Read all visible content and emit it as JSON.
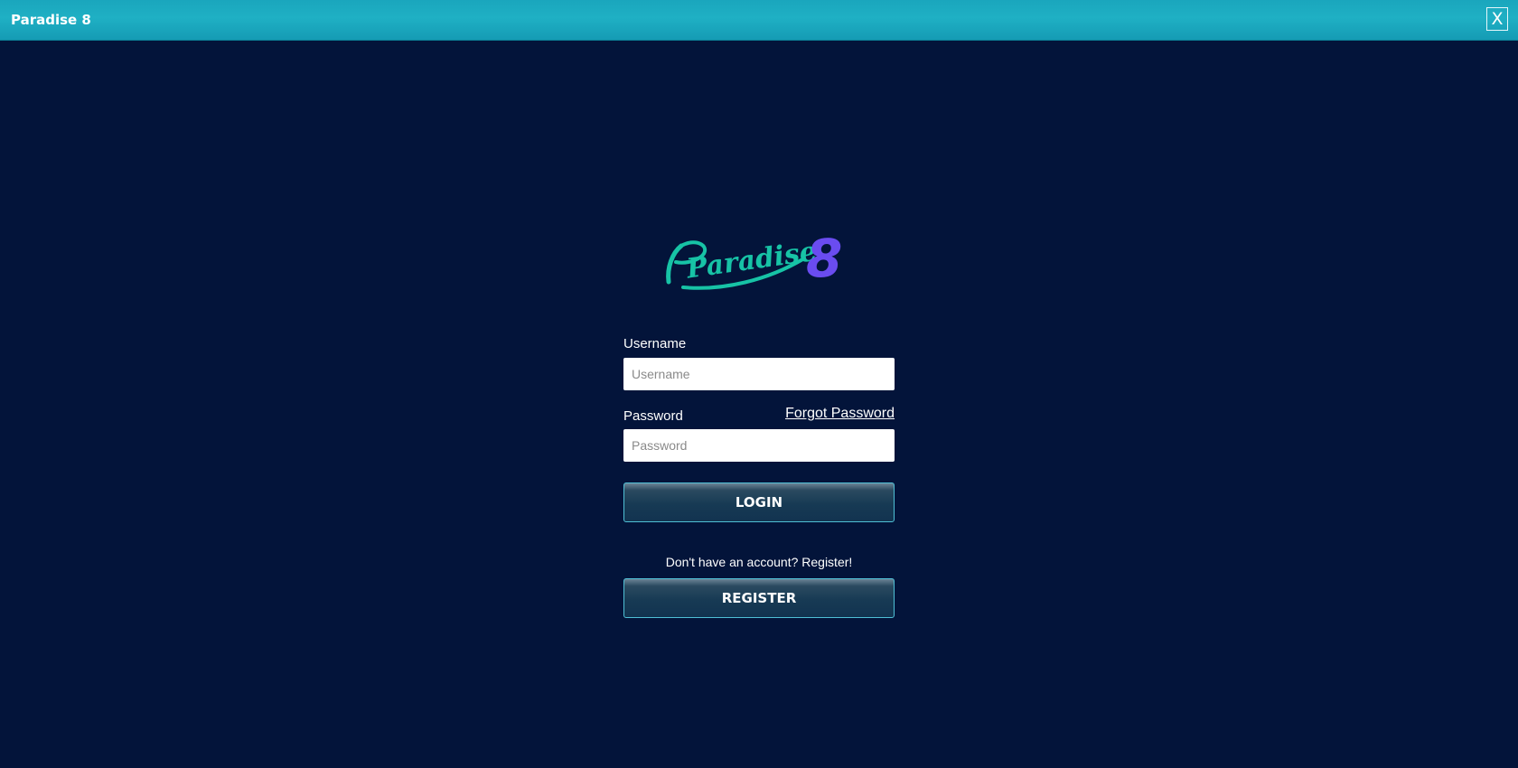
{
  "window": {
    "title": "Paradise 8",
    "close_label": "X"
  },
  "logo": {
    "alt": "Paradise 8",
    "script_text": "Paradise",
    "numeral": "8",
    "script_color": "#17c3a6",
    "numeral_color": "#6a4cf0"
  },
  "login_form": {
    "username_label": "Username",
    "username_placeholder": "Username",
    "username_value": "",
    "password_label": "Password",
    "password_placeholder": "Password",
    "password_value": "",
    "forgot_password_label": "Forgot Password",
    "login_button_label": "LOGIN"
  },
  "register": {
    "prompt": "Don't have an account? Register!",
    "button_label": "REGISTER"
  },
  "colors": {
    "background": "#03143a",
    "titlebar": "#1aa6bd",
    "button_border": "#4fc0d6"
  }
}
